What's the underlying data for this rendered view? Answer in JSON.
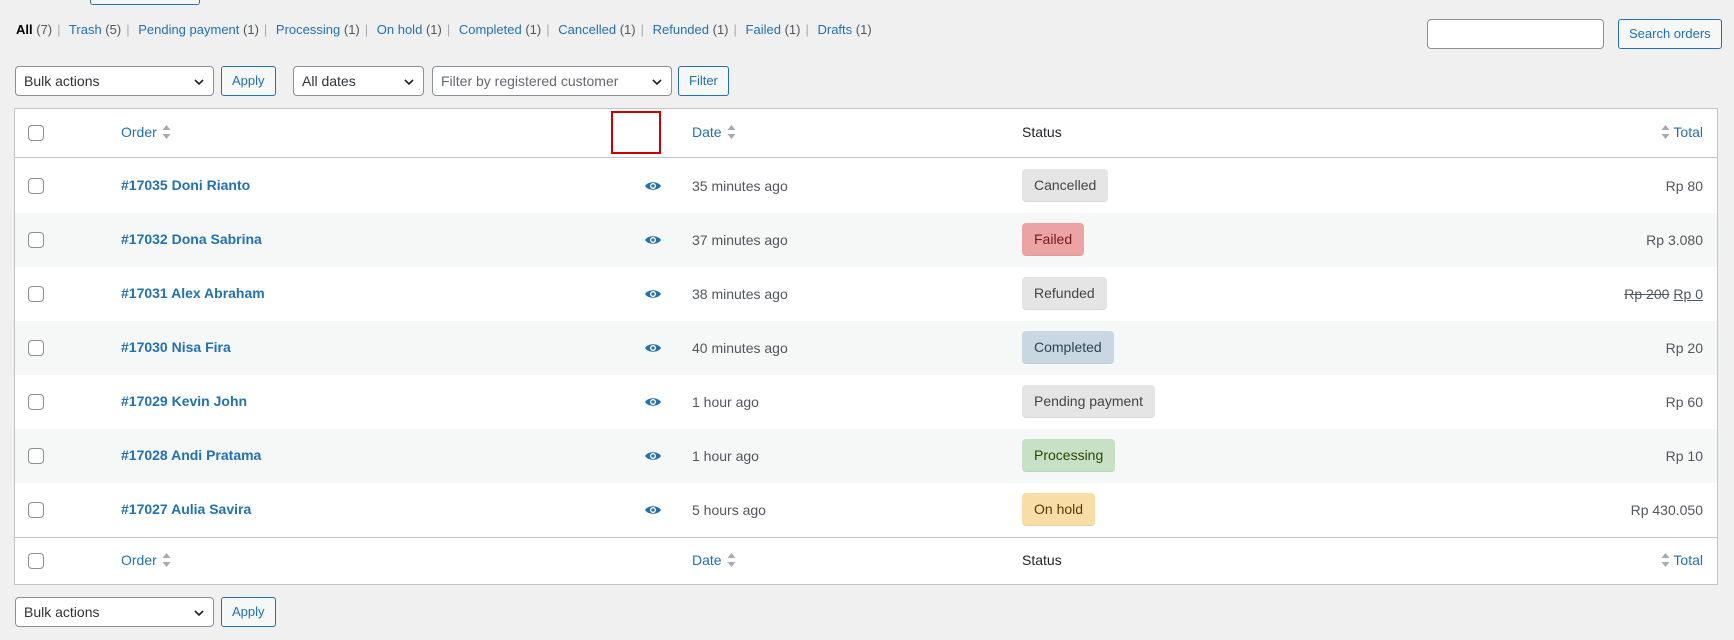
{
  "filters": [
    {
      "label": "All",
      "count": "(7)",
      "current": true
    },
    {
      "label": "Trash",
      "count": "(5)"
    },
    {
      "label": "Pending payment",
      "count": "(1)"
    },
    {
      "label": "Processing",
      "count": "(1)"
    },
    {
      "label": "On hold",
      "count": "(1)"
    },
    {
      "label": "Completed",
      "count": "(1)"
    },
    {
      "label": "Cancelled",
      "count": "(1)"
    },
    {
      "label": "Refunded",
      "count": "(1)"
    },
    {
      "label": "Failed",
      "count": "(1)"
    },
    {
      "label": "Drafts",
      "count": "(1)"
    }
  ],
  "search": {
    "value": "",
    "button": "Search orders"
  },
  "toolbar": {
    "bulk_actions": "Bulk actions",
    "apply": "Apply",
    "dates": "All dates",
    "customer_placeholder": "Filter by registered customer",
    "filter": "Filter"
  },
  "columns": {
    "order": "Order",
    "date": "Date",
    "status": "Status",
    "total": "Total"
  },
  "orders": [
    {
      "label": "#17035 Doni Rianto",
      "date": "35 minutes ago",
      "status": "Cancelled",
      "total": "Rp 80"
    },
    {
      "label": "#17032 Dona Sabrina",
      "date": "37 minutes ago",
      "status": "Failed",
      "total": "Rp 3.080"
    },
    {
      "label": "#17031 Alex Abraham",
      "date": "38 minutes ago",
      "status": "Refunded",
      "total_old": "Rp 200",
      "total": "Rp 0"
    },
    {
      "label": "#17030 Nisa Fira",
      "date": "40 minutes ago",
      "status": "Completed",
      "total": "Rp 20"
    },
    {
      "label": "#17029 Kevin John",
      "date": "1 hour ago",
      "status": "Pending payment",
      "total": "Rp 60"
    },
    {
      "label": "#17028 Andi Pratama",
      "date": "1 hour ago",
      "status": "Processing",
      "total": "Rp 10"
    },
    {
      "label": "#17027 Aulia Savira",
      "date": "5 hours ago",
      "status": "On hold",
      "total": "Rp 430.050"
    }
  ],
  "status_colors": {
    "Cancelled": {
      "bg": "#e5e5e5",
      "fg": "#454545"
    },
    "Failed": {
      "bg": "#eba3a3",
      "fg": "#761919"
    },
    "Refunded": {
      "bg": "#e5e5e5",
      "fg": "#454545"
    },
    "Completed": {
      "bg": "#c8d7e1",
      "fg": "#2e4453"
    },
    "Pending payment": {
      "bg": "#e5e5e5",
      "fg": "#454545"
    },
    "Processing": {
      "bg": "#c6e1c6",
      "fg": "#2c4700"
    },
    "On hold": {
      "bg": "#f8dda7",
      "fg": "#573b00"
    }
  },
  "icons": {
    "preview": "eye-icon",
    "sort": "sort-arrows-icon",
    "dropdown": "chevron-down-icon"
  }
}
